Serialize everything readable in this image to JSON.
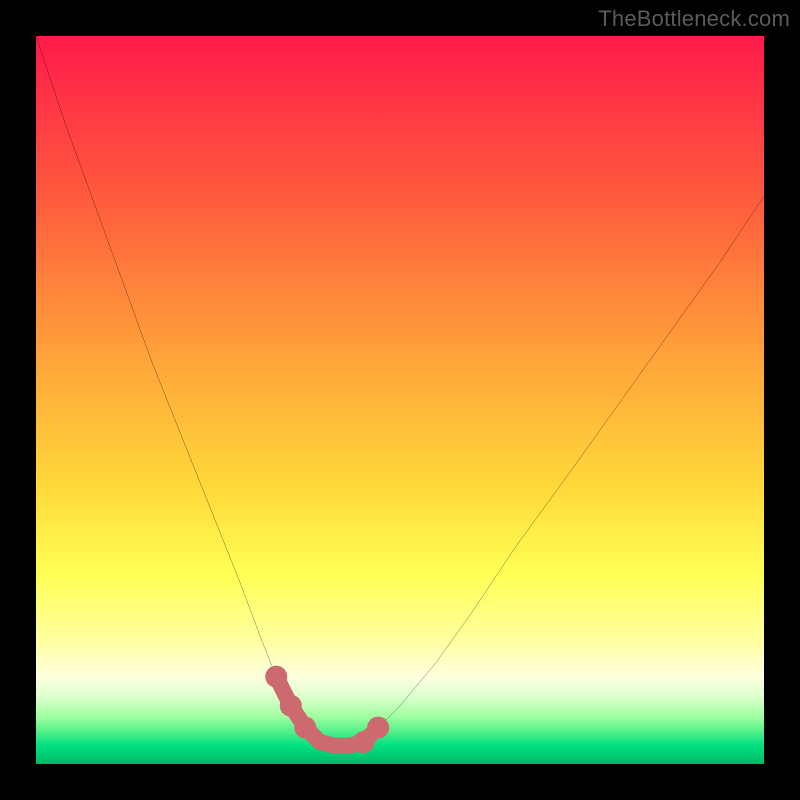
{
  "watermark": {
    "text": "TheBottleneck.com"
  },
  "colors": {
    "black": "#000000",
    "curve": "#000000",
    "accent_pink": "#cd6a6f",
    "top": "#ff1a4b",
    "mid1": "#ff7f3a",
    "mid2": "#ffd93a",
    "mid3": "#ffff66",
    "pale": "#ffffcc",
    "green1": "#7fff7f",
    "green2": "#00e676",
    "green3": "#00c060"
  },
  "chart_data": {
    "type": "line",
    "title": "",
    "xlabel": "",
    "ylabel": "",
    "xlim": [
      0,
      100
    ],
    "ylim": [
      0,
      100
    ],
    "description": "U-shaped bottleneck curve on a vertical red→yellow→green gradient. Curve descends steeply from top-left, flattens to a minimum near x≈38–45 at the bottom green band, then rises toward upper-right. The minimum is emphasized with thick pink overlay segments and dots.",
    "series": [
      {
        "name": "bottleneck-curve",
        "x": [
          0,
          4,
          8,
          12,
          16,
          20,
          24,
          28,
          31,
          33,
          35,
          37,
          39,
          41,
          43,
          45,
          47,
          50,
          55,
          60,
          66,
          74,
          84,
          94,
          100
        ],
        "values": [
          100,
          88,
          77,
          66,
          55,
          45,
          35,
          25,
          17,
          12,
          8,
          5,
          3,
          2.5,
          2.5,
          3,
          5,
          8,
          14,
          21,
          30,
          41,
          55,
          69,
          78
        ]
      }
    ],
    "accent_region": {
      "name": "minimum-highlight",
      "x": [
        33,
        35,
        37,
        39,
        41,
        43,
        45,
        47
      ],
      "values": [
        12,
        8,
        5,
        3,
        2.5,
        2.5,
        3,
        5
      ],
      "dot_x": [
        33,
        35,
        37,
        45,
        47
      ],
      "dot_y": [
        12,
        8,
        5,
        3,
        5
      ]
    }
  }
}
